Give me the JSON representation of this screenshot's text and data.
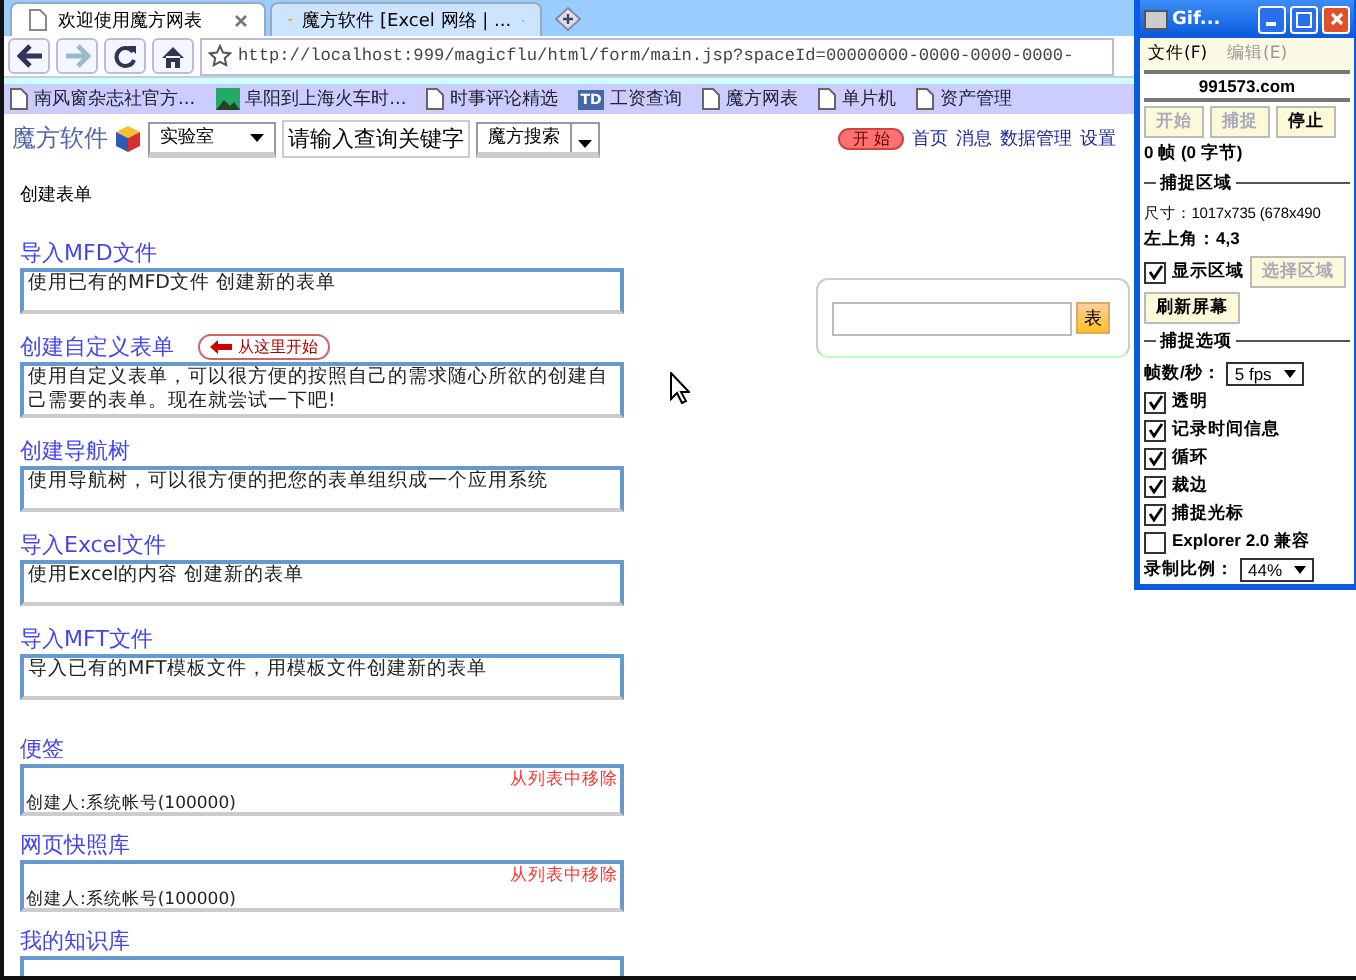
{
  "browser": {
    "tabs": [
      {
        "title": "欢迎使用魔方网表",
        "selected": true
      },
      {
        "title": "魔方软件 [Excel 网络 | ...",
        "selected": false
      }
    ],
    "nav": [
      {
        "kind": "back",
        "disabled": false
      },
      {
        "kind": "forward",
        "disabled": true
      },
      {
        "kind": "reload",
        "disabled": false
      },
      {
        "kind": "home",
        "disabled": false
      }
    ],
    "address": "http://localhost:999/magicflu/html/form/main.jsp?spaceId=00000000-0000-0000-0000-",
    "bookmarks": [
      {
        "label": "南风窗杂志社官方...",
        "kind": "page"
      },
      {
        "label": "阜阳到上海火车时...",
        "kind": "picture"
      },
      {
        "label": "时事评论精选",
        "kind": "page"
      },
      {
        "label": "工资查询",
        "kind": "badge",
        "badge": "TD"
      },
      {
        "label": "魔方网表",
        "kind": "page"
      },
      {
        "label": "单片机",
        "kind": "page"
      },
      {
        "label": "资产管理",
        "kind": "page"
      }
    ]
  },
  "header": {
    "logo": "魔方软件",
    "category": "实验室",
    "search_value": "请输入查询关键字",
    "search_button": "魔方搜索",
    "start_badge": "开 始",
    "links": [
      "首页",
      "消息",
      "数据管理",
      "设置"
    ]
  },
  "heading": "创建表单",
  "sections": [
    {
      "title": "导入MFD文件",
      "description": "使用已有的MFD文件 创建新的表单"
    },
    {
      "title": "创建自定义表单",
      "description": "使用自定义表单，可以很方便的按照自己的需求随心所欲的创建自己需要的表单。现在就尝试一下吧!",
      "callout": "从这里开始"
    },
    {
      "title": "创建导航树",
      "description": "使用导航树，可以很方便的把您的表单组织成一个应用系统"
    },
    {
      "title": "导入Excel文件",
      "description": "使用Excel的内容 创建新的表单"
    },
    {
      "title": "导入MFT文件",
      "description": "导入已有的MFT模板文件，用模板文件创建新的表单"
    }
  ],
  "widgets": [
    {
      "title": "便签",
      "remove_link": "从列表中移除",
      "creator": "创建人:系统帐号(100000)"
    },
    {
      "title": "网页快照库",
      "remove_link": "从列表中移除",
      "creator": "创建人:系统帐号(100000)"
    },
    {
      "title": "我的知识库"
    }
  ],
  "side_search": {
    "button": "表"
  },
  "gif_window": {
    "title": "Gif...",
    "menu": [
      {
        "label": "文件(F)",
        "disabled": false
      },
      {
        "label": "编辑(E)",
        "disabled": true
      }
    ],
    "site": "991573.com",
    "buttons": [
      {
        "label": "开始",
        "disabled": true
      },
      {
        "label": "捕捉",
        "disabled": true
      },
      {
        "label": "停止",
        "disabled": false
      }
    ],
    "frames": "0 帧 (0 字节)",
    "area_group": "捕捉区域",
    "size": "尺寸：1017x735 (678x490",
    "corner": "左上角：4,3",
    "show_area": {
      "label": "显示区域",
      "checked": true
    },
    "select_area": {
      "label": "选择区域",
      "disabled": true
    },
    "refresh": "刷新屏幕",
    "options_group": "捕捉选项",
    "fps_label": "帧数/秒：",
    "fps": "5 fps",
    "options": [
      {
        "label": "透明",
        "checked": true
      },
      {
        "label": "记录时间信息",
        "checked": true
      },
      {
        "label": "循环",
        "checked": true
      },
      {
        "label": "裁边",
        "checked": true
      },
      {
        "label": "捕捉光标",
        "checked": true
      },
      {
        "label": "Explorer 2.0 兼容",
        "checked": false
      }
    ],
    "scale_label": "录制比例：",
    "scale": "44%"
  }
}
